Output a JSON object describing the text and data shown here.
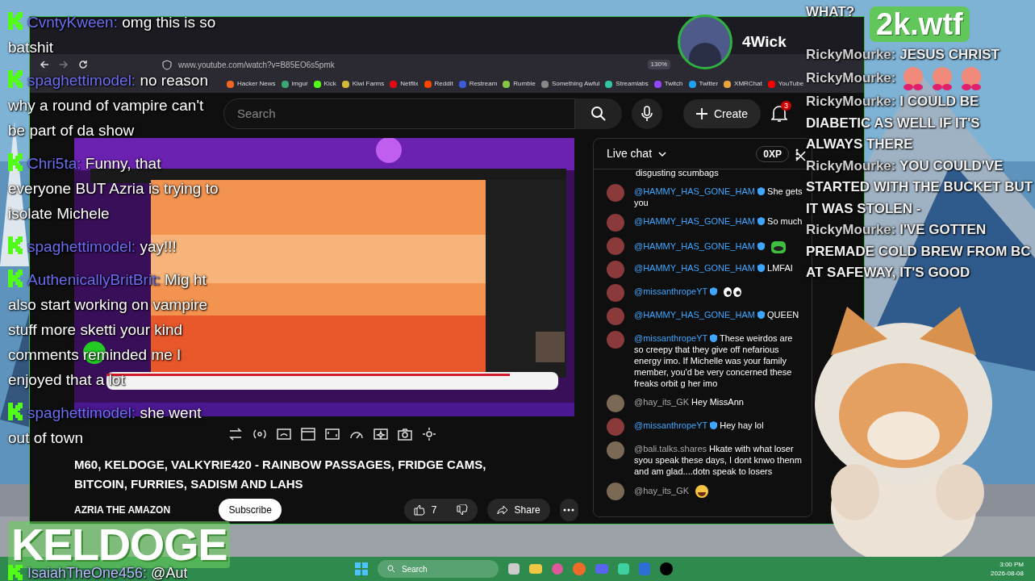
{
  "browser": {
    "url": "www.youtube.com/watch?v=B85EO6s5pmk",
    "zoom": "130%",
    "bookmarks": [
      "Hacker News",
      "imgur",
      "Kick",
      "Kiwi Farms",
      "Netflix",
      "Reddit",
      "Restream",
      "Rumble",
      "Something Awful",
      "Streamlabs",
      "Twitch",
      "Twitter",
      "XMRChat",
      "YouTube"
    ]
  },
  "youtube": {
    "search_placeholder": "Search",
    "create": "Create",
    "notifications": "3",
    "video": {
      "title": "M60, KELDOGE, VALKYRIE420 - RAINBOW PASSAGES, FRIDGE CAMS, BITCOIN, FURRIES, SADISM AND LAHS",
      "channel": "AZRIA THE AMAZON",
      "subscribe": "Subscribe",
      "likes": "7",
      "share": "Share"
    },
    "live_chat": {
      "title": "Live chat",
      "xp": "0XP",
      "messages": [
        {
          "kind": "tail",
          "text": "disgusting scumbags"
        },
        {
          "kind": "text",
          "user": "@HAMMY_HAS_GONE_HAM",
          "verified": true,
          "text": "She gets you"
        },
        {
          "kind": "text",
          "user": "@HAMMY_HAS_GONE_HAM",
          "verified": true,
          "text": "So much"
        },
        {
          "kind": "frog",
          "user": "@HAMMY_HAS_GONE_HAM",
          "verified": true
        },
        {
          "kind": "text",
          "user": "@HAMMY_HAS_GONE_HAM",
          "verified": true,
          "text": "LMFAI"
        },
        {
          "kind": "eyes",
          "user": "@missanthropeYT",
          "verified": true
        },
        {
          "kind": "text",
          "user": "@HAMMY_HAS_GONE_HAM",
          "verified": true,
          "text": "QUEEN"
        },
        {
          "kind": "text",
          "user": "@missanthropeYT",
          "verified": true,
          "text": "These weirdos are so creepy that they give off nefarious energy imo. If Michelle was your family member, you'd be very concerned these freaks orbit g her imo"
        },
        {
          "kind": "text",
          "user": "@hay_its_GK",
          "verified": false,
          "text": "Hey MissAnn"
        },
        {
          "kind": "text",
          "user": "@missanthropeYT",
          "verified": true,
          "text": "Hey hay lol"
        },
        {
          "kind": "text",
          "user": "@bali.talks.shares",
          "verified": false,
          "text": "Hkate with what loser syou speak these days, I dont knwo thenm and am glad....dotn speak to losers"
        },
        {
          "kind": "laugh",
          "user": "@hay_its_GK",
          "verified": false
        }
      ]
    }
  },
  "stream_chat": [
    {
      "user": "CvntyKween:",
      "text": "omg this is so batshit"
    },
    {
      "user": "spaghettimodel:",
      "text": "no reason why a round of vampire can't be part of da show"
    },
    {
      "user": "Chri5ta:",
      "text": "Funny, that everyone BUT Azria is trying to isolate Michele"
    },
    {
      "user": "spaghettimodel:",
      "text": "yay!!!"
    },
    {
      "user": "AuthenicallyBritBrit:",
      "text": "Mig ht also start working on vampire stuff more sketti your kind comments reminded me I enjoyed that a lot"
    },
    {
      "user": "spaghettimodel:",
      "text": "she went out of town"
    }
  ],
  "stream_chat_last": {
    "user": "IsaiahTheOne456:",
    "text": "@Aut"
  },
  "side_chat": [
    {
      "kind": "plain",
      "text": "WHAT?"
    },
    {
      "kind": "message",
      "user": "RickyMourke:",
      "text": "JESUS CHRIST"
    },
    {
      "kind": "emotes",
      "user": "RickyMourke:"
    },
    {
      "kind": "message",
      "user": "RickyMourke:",
      "text": "I COULD BE DIABETIC AS WELL IF IT'S ALWAYS THERE"
    },
    {
      "kind": "message",
      "user": "RickyMourke:",
      "text": "YOU COULD'VE STARTED WITH THE BUCKET BUT IT WAS STOLEN -"
    },
    {
      "kind": "message",
      "user": "RickyMourke:",
      "text": "I'VE GOTTEN PREMADE COLD BREW FROM BC AT SAFEWAY, IT'S GOOD"
    }
  ],
  "overlay": {
    "guest_name": "4Wick",
    "site_logo": "2k.wtf",
    "show_logo": "KELDOGE"
  },
  "taskbar": {
    "search": "Search",
    "time": "3:00 PM",
    "date": "2026-08-08"
  }
}
